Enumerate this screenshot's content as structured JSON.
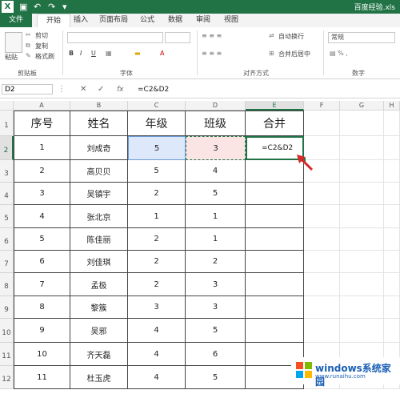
{
  "titlebar": {
    "title": "百度经验.xls",
    "app_badge": "X"
  },
  "tabs": [
    "文件",
    "开始",
    "插入",
    "页面布局",
    "公式",
    "数据",
    "审阅",
    "视图"
  ],
  "ribbon": {
    "paste": "粘贴",
    "cut": "剪切",
    "copy": "复制",
    "format_painter": "格式刷",
    "wrap_text": "自动换行",
    "merge_center": "合并后居中",
    "number_format": "常规",
    "groups": [
      "剪贴板",
      "字体",
      "对齐方式",
      "数字"
    ],
    "bold": "B",
    "italic": "I",
    "underline": "U"
  },
  "formula_bar": {
    "name_box": "D2",
    "content": "=C2&D2",
    "fx": "fx"
  },
  "columns": [
    "A",
    "B",
    "C",
    "D",
    "E",
    "F",
    "G",
    "H"
  ],
  "row_numbers": [
    "1",
    "2",
    "3",
    "4",
    "5",
    "6",
    "7",
    "8",
    "9",
    "10",
    "11",
    "12"
  ],
  "table": {
    "headers": [
      "序号",
      "姓名",
      "年级",
      "班级",
      "合并"
    ],
    "rows": [
      [
        "1",
        "刘成奇",
        "5",
        "3",
        "=C2&D2"
      ],
      [
        "2",
        "高贝贝",
        "5",
        "4",
        ""
      ],
      [
        "3",
        "吴镇宇",
        "2",
        "5",
        ""
      ],
      [
        "4",
        "张北京",
        "1",
        "1",
        ""
      ],
      [
        "5",
        "陈佳丽",
        "2",
        "1",
        ""
      ],
      [
        "6",
        "刘佳琪",
        "2",
        "2",
        ""
      ],
      [
        "7",
        "孟极",
        "2",
        "3",
        ""
      ],
      [
        "8",
        "黎簇",
        "3",
        "3",
        ""
      ],
      [
        "9",
        "吴邪",
        "4",
        "5",
        ""
      ],
      [
        "10",
        "齐天磊",
        "4",
        "6",
        ""
      ],
      [
        "11",
        "杜玉虎",
        "4",
        "5",
        ""
      ]
    ]
  },
  "watermark": {
    "brand": "windows系统家园",
    "url": "www.runaihu.com"
  },
  "colors": {
    "excel_green": "#217346",
    "c2_fill": "#dde8fb",
    "d2_fill": "#fbe4e4",
    "arrow": "#d42a2a"
  }
}
